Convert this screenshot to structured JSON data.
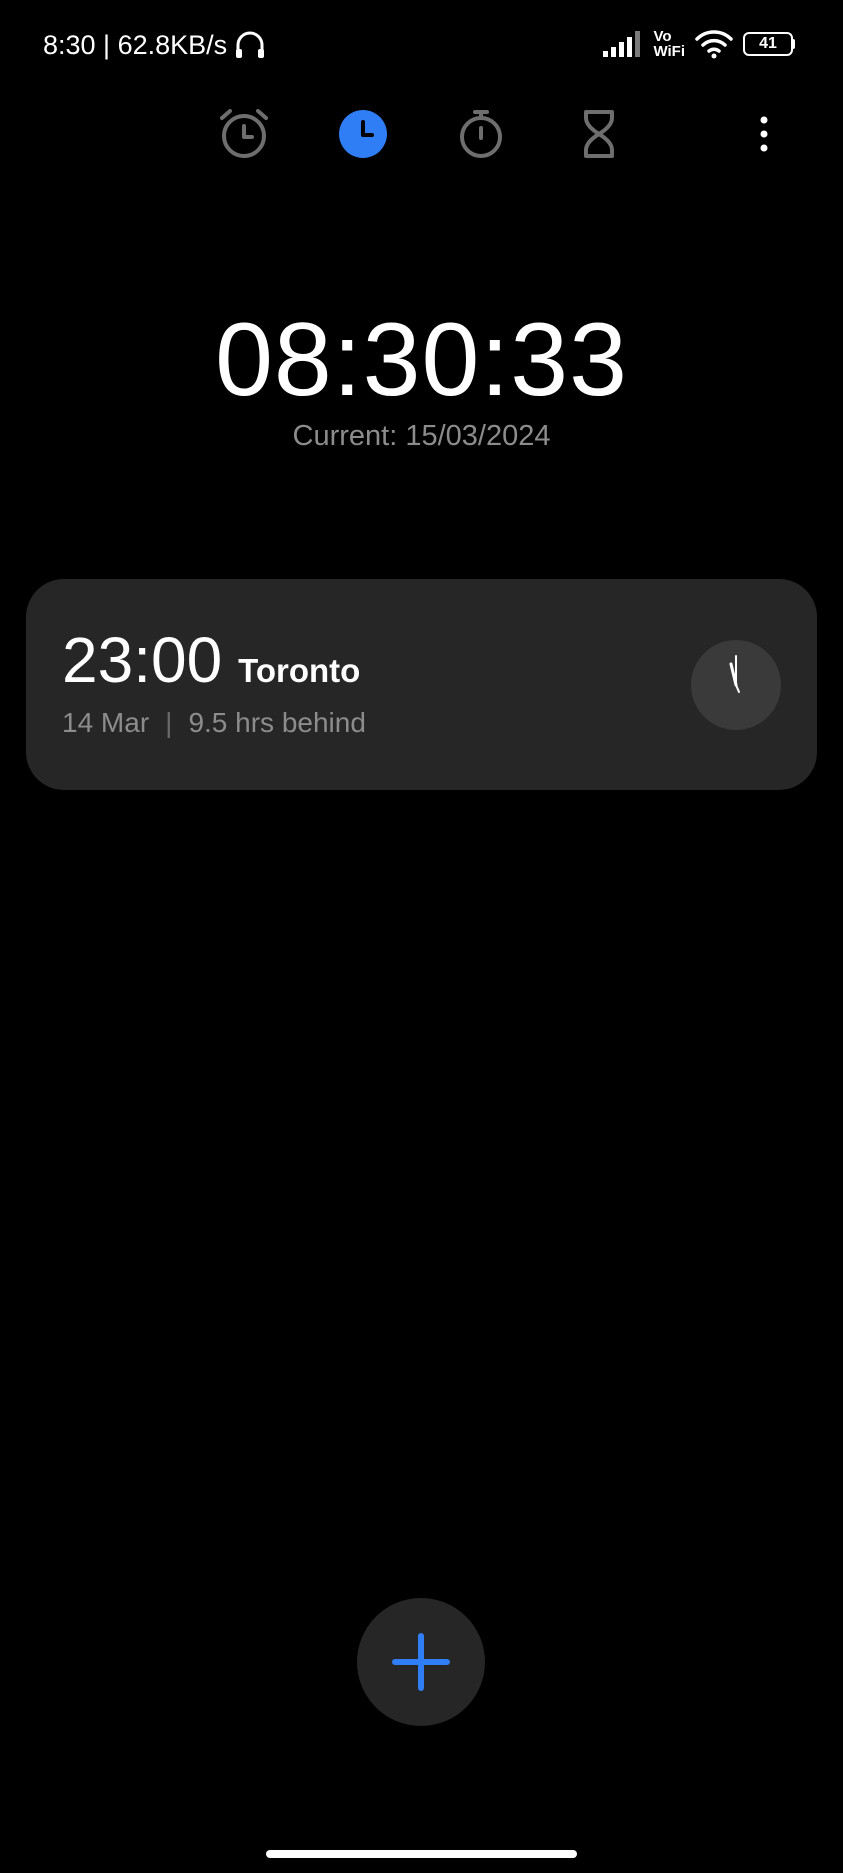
{
  "status_bar": {
    "time_speed": "8:30 | 62.8KB/s",
    "vowifi_line1": "Vo",
    "vowifi_line2": "WiFi",
    "battery": "41"
  },
  "tabs": [
    {
      "name": "alarm",
      "icon": "alarm-clock-icon",
      "active": false
    },
    {
      "name": "clock",
      "icon": "clock-icon",
      "active": true
    },
    {
      "name": "stopwatch",
      "icon": "stopwatch-icon",
      "active": false
    },
    {
      "name": "timer",
      "icon": "hourglass-icon",
      "active": false
    }
  ],
  "main": {
    "time": "08:30:33",
    "current_date": "Current: 15/03/2024"
  },
  "world_clocks": [
    {
      "time": "23:00",
      "city": "Toronto",
      "date": "14 Mar",
      "separator": "|",
      "offset": "9.5 hrs behind"
    }
  ],
  "colors": {
    "background": "#000000",
    "card": "#262626",
    "accent": "#2f7ef5",
    "inactive_icon": "#6e6e6e",
    "secondary_text": "#8c8c8c"
  }
}
